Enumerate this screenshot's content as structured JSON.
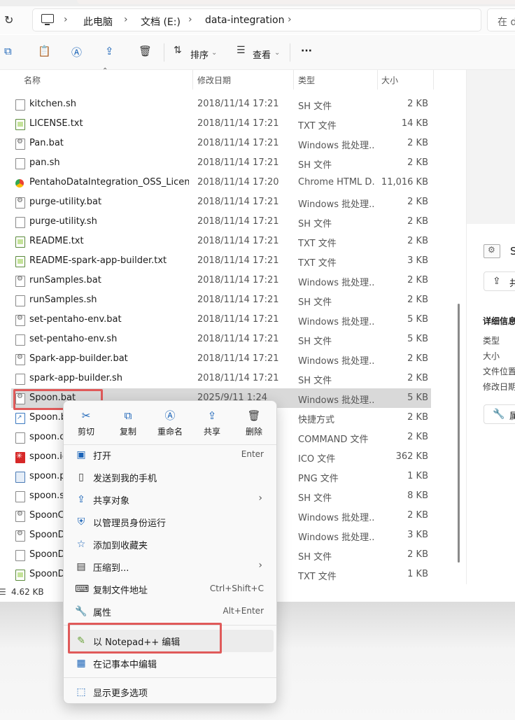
{
  "address": {
    "crumbs": [
      "此电脑",
      "文档 (E:)",
      "data-integration"
    ],
    "search_placeholder": "在 d"
  },
  "toolbar": {
    "sort_label": "排序",
    "view_label": "查看",
    "more_label": "···"
  },
  "columns": {
    "name": "名称",
    "date": "修改日期",
    "type": "类型",
    "size": "大小"
  },
  "files": [
    {
      "name": "kitchen.sh",
      "date": "2018/11/14 17:21",
      "type": "SH 文件",
      "size": "2 KB",
      "icon": "sh-file-icon"
    },
    {
      "name": "LICENSE.txt",
      "date": "2018/11/14 17:21",
      "type": "TXT 文件",
      "size": "14 KB",
      "icon": "txt-file-icon"
    },
    {
      "name": "Pan.bat",
      "date": "2018/11/14 17:21",
      "type": "Windows 批处理...",
      "size": "2 KB",
      "icon": "bat-file-icon"
    },
    {
      "name": "pan.sh",
      "date": "2018/11/14 17:21",
      "type": "SH 文件",
      "size": "2 KB",
      "icon": "sh-file-icon"
    },
    {
      "name": "PentahoDataIntegration_OSS_License...",
      "date": "2018/11/14 17:20",
      "type": "Chrome HTML D...",
      "size": "11,016 KB",
      "icon": "chrome-html-icon"
    },
    {
      "name": "purge-utility.bat",
      "date": "2018/11/14 17:21",
      "type": "Windows 批处理...",
      "size": "2 KB",
      "icon": "bat-file-icon"
    },
    {
      "name": "purge-utility.sh",
      "date": "2018/11/14 17:21",
      "type": "SH 文件",
      "size": "2 KB",
      "icon": "sh-file-icon"
    },
    {
      "name": "README.txt",
      "date": "2018/11/14 17:21",
      "type": "TXT 文件",
      "size": "2 KB",
      "icon": "txt-file-icon"
    },
    {
      "name": "README-spark-app-builder.txt",
      "date": "2018/11/14 17:21",
      "type": "TXT 文件",
      "size": "3 KB",
      "icon": "txt-file-icon"
    },
    {
      "name": "runSamples.bat",
      "date": "2018/11/14 17:21",
      "type": "Windows 批处理...",
      "size": "2 KB",
      "icon": "bat-file-icon"
    },
    {
      "name": "runSamples.sh",
      "date": "2018/11/14 17:21",
      "type": "SH 文件",
      "size": "2 KB",
      "icon": "sh-file-icon"
    },
    {
      "name": "set-pentaho-env.bat",
      "date": "2018/11/14 17:21",
      "type": "Windows 批处理...",
      "size": "5 KB",
      "icon": "bat-file-icon"
    },
    {
      "name": "set-pentaho-env.sh",
      "date": "2018/11/14 17:21",
      "type": "SH 文件",
      "size": "5 KB",
      "icon": "sh-file-icon"
    },
    {
      "name": "Spark-app-builder.bat",
      "date": "2018/11/14 17:21",
      "type": "Windows 批处理...",
      "size": "2 KB",
      "icon": "bat-file-icon"
    },
    {
      "name": "spark-app-builder.sh",
      "date": "2018/11/14 17:21",
      "type": "SH 文件",
      "size": "2 KB",
      "icon": "sh-file-icon"
    },
    {
      "name": "Spoon.bat",
      "date": "2025/9/11 1:24",
      "type": "Windows 批处理...",
      "size": "5 KB",
      "icon": "bat-file-icon",
      "selected": true
    },
    {
      "name": "Spoon.b",
      "date": "",
      "type": "快捷方式",
      "size": "2 KB",
      "icon": "shortcut-icon"
    },
    {
      "name": "spoon.c",
      "date": "",
      "type": "COMMAND 文件",
      "size": "2 KB",
      "icon": "sh-file-icon"
    },
    {
      "name": "spoon.ic",
      "date": "",
      "type": "ICO 文件",
      "size": "362 KB",
      "icon": "ico-file-icon"
    },
    {
      "name": "spoon.p",
      "date": "",
      "type": "PNG 文件",
      "size": "1 KB",
      "icon": "png-file-icon"
    },
    {
      "name": "spoon.s",
      "date": "",
      "type": "SH 文件",
      "size": "8 KB",
      "icon": "sh-file-icon"
    },
    {
      "name": "SpoonC",
      "date": "",
      "type": "Windows 批处理...",
      "size": "2 KB",
      "icon": "bat-file-icon"
    },
    {
      "name": "SpoonD",
      "date": "",
      "type": "Windows 批处理...",
      "size": "3 KB",
      "icon": "bat-file-icon"
    },
    {
      "name": "SpoonD",
      "date": "",
      "type": "SH 文件",
      "size": "2 KB",
      "icon": "sh-file-icon"
    },
    {
      "name": "SpoonD",
      "date": "",
      "type": "TXT 文件",
      "size": "1 KB",
      "icon": "txt-file-icon"
    }
  ],
  "status": {
    "size_text": "4.62 KB"
  },
  "details_pane": {
    "title_initial": "S",
    "share_btn": "共",
    "heading": "详细信息",
    "labels": [
      "类型",
      "大小",
      "文件位置",
      "修改日期"
    ],
    "props_btn": "属"
  },
  "context_menu": {
    "quick_actions": [
      {
        "label": "剪切",
        "icon": "cut-icon"
      },
      {
        "label": "复制",
        "icon": "copy-icon"
      },
      {
        "label": "重命名",
        "icon": "rename-icon"
      },
      {
        "label": "共享",
        "icon": "share-icon"
      },
      {
        "label": "删除",
        "icon": "delete-icon"
      }
    ],
    "items": [
      {
        "label": "打开",
        "shortcut": "Enter",
        "icon": "open-icon"
      },
      {
        "label": "发送到我的手机",
        "shortcut": "",
        "icon": "phone-icon"
      },
      {
        "label": "共享对象",
        "shortcut": "",
        "icon": "share-object-icon",
        "submenu": true
      },
      {
        "label": "以管理员身份运行",
        "shortcut": "",
        "icon": "shield-icon"
      },
      {
        "label": "添加到收藏夹",
        "shortcut": "",
        "icon": "star-icon"
      },
      {
        "label": "压缩到...",
        "shortcut": "",
        "icon": "zip-icon",
        "submenu": true
      },
      {
        "label": "复制文件地址",
        "shortcut": "Ctrl+Shift+C",
        "icon": "copy-path-icon"
      },
      {
        "label": "属性",
        "shortcut": "Alt+Enter",
        "icon": "wrench-icon"
      },
      {
        "label": "以 Notepad++ 编辑",
        "shortcut": "",
        "icon": "notepadpp-icon"
      },
      {
        "label": "在记事本中编辑",
        "shortcut": "",
        "icon": "notepad-icon"
      },
      {
        "label": "显示更多选项",
        "shortcut": "",
        "icon": "more-options-icon"
      }
    ]
  },
  "colors": {
    "accent": "#1b64b8",
    "highlight_box": "#e05a5a",
    "selected_row": "#d9d9d9"
  }
}
